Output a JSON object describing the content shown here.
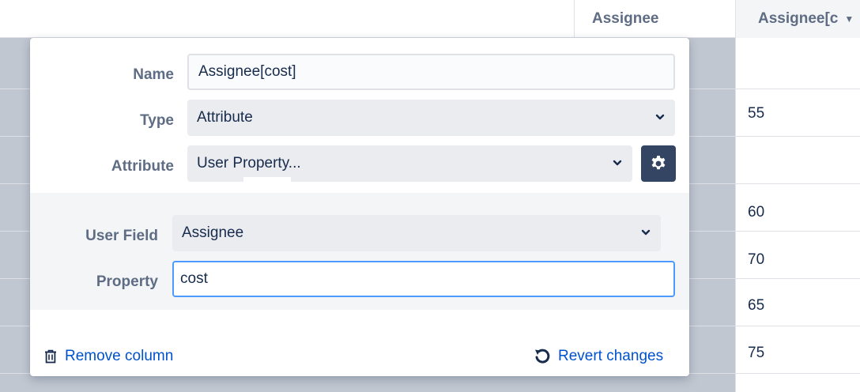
{
  "table": {
    "headers": [
      "Assignee",
      "Assignee[c"
    ],
    "values": [
      "55",
      "60",
      "70",
      "65",
      "75"
    ]
  },
  "popup": {
    "name_label": "Name",
    "name_value": "Assignee[cost]",
    "type_label": "Type",
    "type_value": "Attribute",
    "attribute_label": "Attribute",
    "attribute_value": "User Property...",
    "user_field_label": "User Field",
    "user_field_value": "Assignee",
    "property_label": "Property",
    "property_value": "cost",
    "remove_label": "Remove column",
    "revert_label": "Revert changes"
  },
  "icons": {
    "chevron": "chevron-down-icon",
    "gear": "gear-icon",
    "trash": "trash-icon",
    "revert": "revert-icon",
    "sort": "sort-down-icon"
  },
  "colors": {
    "link": "#0052cc",
    "focus_border": "#4c9aff",
    "gear_button": "#344563"
  }
}
